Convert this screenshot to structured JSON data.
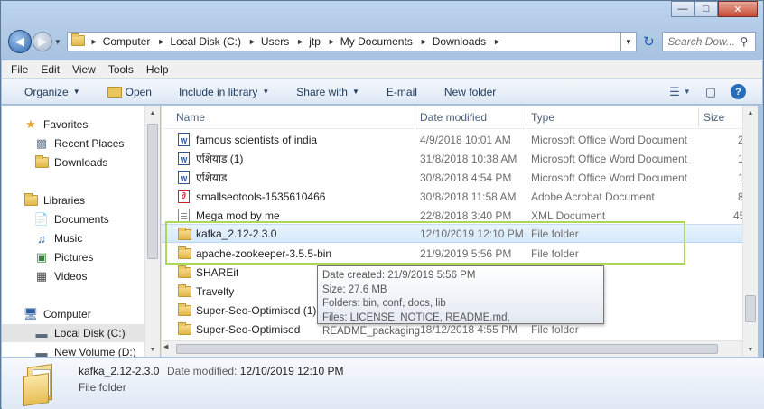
{
  "address": {
    "crumbs": [
      "Computer",
      "Local Disk (C:)",
      "Users",
      "jtp",
      "My Documents",
      "Downloads"
    ]
  },
  "search": {
    "placeholder": "Search Dow..."
  },
  "menu": [
    "File",
    "Edit",
    "View",
    "Tools",
    "Help"
  ],
  "commands": {
    "organize": "Organize",
    "open": "Open",
    "include": "Include in library",
    "share": "Share with",
    "email": "E-mail",
    "newfolder": "New folder"
  },
  "navpane": {
    "favorites": "Favorites",
    "recent": "Recent Places",
    "downloads": "Downloads",
    "libraries": "Libraries",
    "documents": "Documents",
    "music": "Music",
    "pictures": "Pictures",
    "videos": "Videos",
    "computer": "Computer",
    "localdisk": "Local Disk (C:)",
    "newvolume": "New Volume (D:)"
  },
  "columns": {
    "name": "Name",
    "date": "Date modified",
    "type": "Type",
    "size": "Size"
  },
  "files": [
    {
      "name": "famous scientists of india",
      "date": "4/9/2018 10:01 AM",
      "type": "Microsoft Office Word Document",
      "size": "2",
      "icon": "word-icon"
    },
    {
      "name": "एशियाड (1)",
      "date": "31/8/2018 10:38 AM",
      "type": "Microsoft Office Word Document",
      "size": "1",
      "icon": "word-icon"
    },
    {
      "name": "एशियाड",
      "date": "30/8/2018 4:54 PM",
      "type": "Microsoft Office Word Document",
      "size": "1",
      "icon": "word-icon"
    },
    {
      "name": "smallseotools-1535610466",
      "date": "30/8/2018 11:58 AM",
      "type": "Adobe Acrobat Document",
      "size": "8",
      "icon": "pdf-icon"
    },
    {
      "name": "Mega mod by me",
      "date": "22/8/2018 3:40 PM",
      "type": "XML Document",
      "size": "45",
      "icon": "xml-icon"
    },
    {
      "name": "kafka_2.12-2.3.0",
      "date": "12/10/2019 12:10 PM",
      "type": "File folder",
      "size": "",
      "icon": "folder-icon"
    },
    {
      "name": "apache-zookeeper-3.5.5-bin",
      "date": "21/9/2019 5:56 PM",
      "type": "File folder",
      "size": "",
      "icon": "folder-icon"
    },
    {
      "name": "SHAREit",
      "date": "",
      "type": "",
      "size": "",
      "icon": "folder-icon"
    },
    {
      "name": "Travelty",
      "date": "",
      "type": "",
      "size": "",
      "icon": "folder-icon"
    },
    {
      "name": "Super-Seo-Optimised (1)",
      "date": "",
      "type": "",
      "size": "",
      "icon": "folder-icon"
    },
    {
      "name": "Super-Seo-Optimised",
      "date": "18/12/2018 4:55 PM",
      "type": "File folder",
      "size": "",
      "icon": "folder-icon"
    }
  ],
  "tooltip": {
    "created": "Date created: 21/9/2019 5:56 PM",
    "size": "Size: 27.6 MB",
    "folders": "Folders: bin, conf, docs, lib",
    "files": "Files: LICENSE, NOTICE, README.md, README_packaging"
  },
  "details": {
    "name": "kafka_2.12-2.3.0",
    "meta_label": "Date modified:",
    "meta_value": "12/10/2019 12:10 PM",
    "type": "File folder"
  },
  "colors": {
    "selection": "#d6e9fb",
    "highlight_border": "#a9d85a"
  }
}
